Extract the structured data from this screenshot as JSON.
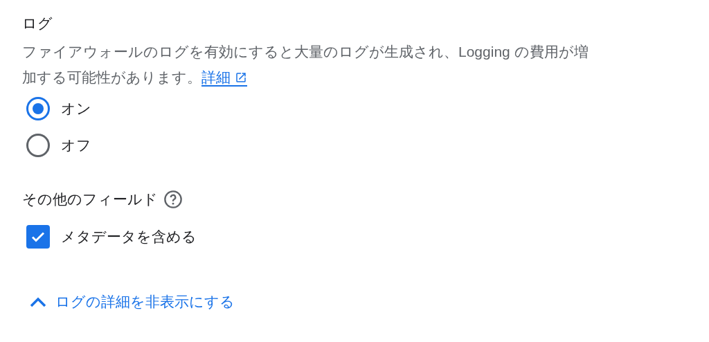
{
  "log_section": {
    "title": "ログ",
    "description": "ファイアウォールのログを有効にすると大量のログが生成され、Logging の費用が増加する可能性があります。",
    "link": "詳細",
    "options": [
      {
        "label": "オン",
        "selected": true
      },
      {
        "label": "オフ",
        "selected": false
      }
    ]
  },
  "extra_fields": {
    "title": "その他のフィールド",
    "checkbox": {
      "label": "メタデータを含める",
      "checked": true
    }
  },
  "toggle_link": {
    "label": "ログの詳細を非表示にする",
    "expanded": true
  }
}
